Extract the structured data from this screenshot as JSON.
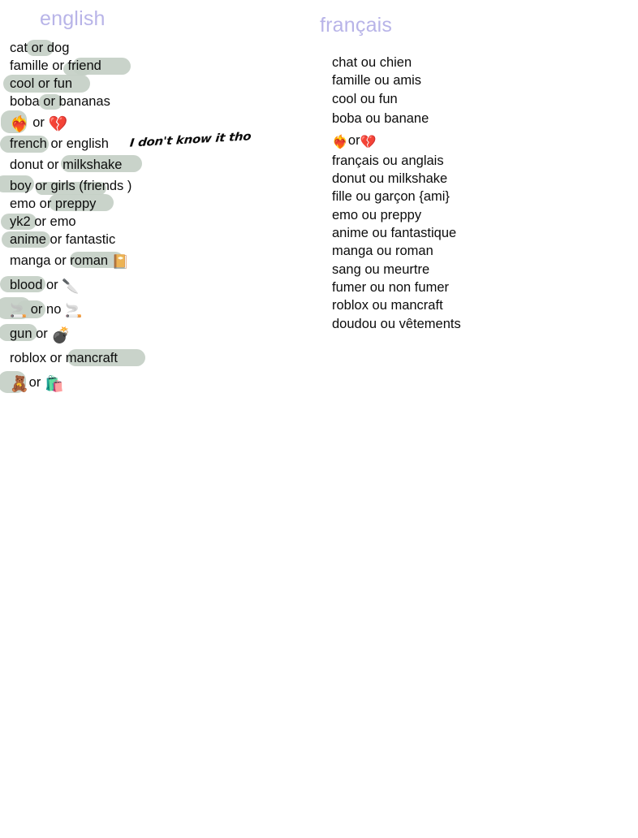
{
  "page": {
    "background_color": "#ffffff",
    "highlight_color": "#c5d0c6",
    "heading_color": "#b8b4e8",
    "text_color": "#0c0c0c"
  },
  "columns": {
    "english": {
      "title": "english",
      "lines": [
        {
          "text": "cat or dog"
        },
        {
          "text": "famille or friend"
        },
        {
          "text": "cool or fun"
        },
        {
          "text": "boba or bananas"
        },
        {
          "pre_emoji": "❤️‍🔥",
          "text": " or ",
          "post_emoji": "💔"
        },
        {
          "text": "french or english"
        },
        {
          "text": "donut or milkshake"
        },
        {
          "text": "boy or girls (friends )"
        },
        {
          "text": "emo  or preppy"
        },
        {
          "text": "yk2 or emo"
        },
        {
          "text": "anime or fantastic"
        },
        {
          "text": "manga or roman ",
          "post_emoji": "📔"
        },
        {
          "text": "blood or ",
          "post_emoji": "🔪"
        },
        {
          "pre_emoji": "🚬",
          "text": " or no ",
          "post_emoji": "🚬"
        },
        {
          "text": "gun or ",
          "post_emoji": "💣"
        },
        {
          "text": "roblox or mancraft"
        },
        {
          "pre_emoji": "🧸",
          "text": "or ",
          "post_emoji": "🛍️"
        }
      ]
    },
    "francais": {
      "title": "français",
      "lines": [
        {
          "text": "chat ou chien"
        },
        {
          "text": "famille ou amis"
        },
        {
          "text": "cool ou fun"
        },
        {
          "text": "boba ou banane"
        },
        {
          "pre_emoji": "❤️‍🔥",
          "text": "or",
          "post_emoji": "💔"
        },
        {
          "text": "français ou anglais"
        },
        {
          "text": "donut ou milkshake"
        },
        {
          "text": "fille ou garçon {ami}"
        },
        {
          "text": "emo ou preppy"
        },
        {
          "text": "anime ou fantastique"
        },
        {
          "text": "manga ou roman"
        },
        {
          "text": "sang ou meurtre"
        },
        {
          "text": "fumer ou non fumer"
        },
        {
          "text": "roblox ou mancraft"
        },
        {
          "text": "doudou ou vêtements"
        }
      ]
    }
  },
  "annotation": {
    "handwritten_note": "I don't know it tho"
  }
}
